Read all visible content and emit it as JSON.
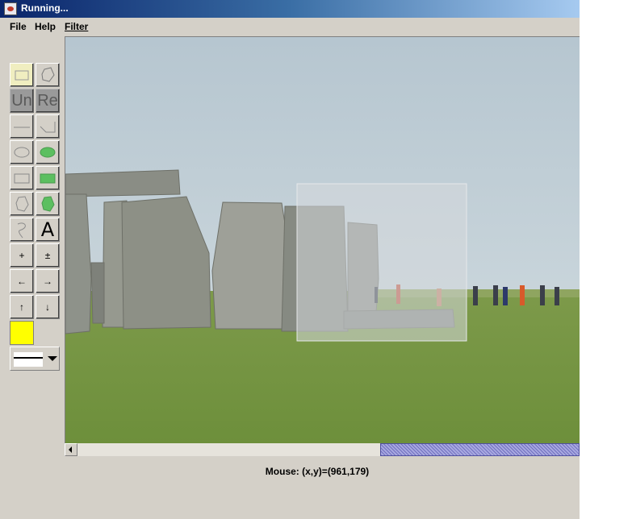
{
  "window": {
    "title": "Running..."
  },
  "menubar": {
    "items": [
      "File",
      "Help",
      "Filter"
    ]
  },
  "toolbar": {
    "buttons": [
      {
        "name": "select-rectangle-tool",
        "icon": "rectangle-select-icon",
        "selected": true
      },
      {
        "name": "select-lasso-tool",
        "icon": "lasso-select-icon"
      },
      {
        "name": "undo-button",
        "label": "Un",
        "disabled": true
      },
      {
        "name": "redo-button",
        "label": "Re",
        "disabled": true
      },
      {
        "name": "line-tool",
        "icon": "line-icon"
      },
      {
        "name": "polyline-tool",
        "icon": "polyline-icon"
      },
      {
        "name": "ellipse-tool",
        "icon": "ellipse-outline-icon"
      },
      {
        "name": "filled-ellipse-tool",
        "icon": "ellipse-filled-icon"
      },
      {
        "name": "rectangle-tool",
        "icon": "rectangle-outline-icon"
      },
      {
        "name": "filled-rectangle-tool",
        "icon": "rectangle-filled-icon"
      },
      {
        "name": "polygon-tool",
        "icon": "polygon-outline-icon"
      },
      {
        "name": "filled-polygon-tool",
        "icon": "polygon-filled-icon"
      },
      {
        "name": "freehand-tool",
        "icon": "freehand-icon"
      },
      {
        "name": "text-tool",
        "label": "A"
      },
      {
        "name": "zoom-in-button",
        "label": "+"
      },
      {
        "name": "zoom-toggle-button",
        "label": "±"
      },
      {
        "name": "move-left-button",
        "label": "←"
      },
      {
        "name": "move-right-button",
        "label": "→"
      },
      {
        "name": "move-up-button",
        "label": "↑"
      },
      {
        "name": "move-down-button",
        "label": "↓"
      }
    ],
    "color_swatch": "#ffff00",
    "line_style": "solid"
  },
  "status": {
    "mouse_text": "Mouse: (x,y)=(961,179)"
  },
  "colors": {
    "titlebar_start": "#0a246a",
    "titlebar_end": "#a6caf0",
    "window_bg": "#d4d0c8",
    "scroll_thumb": "#9090d0",
    "tool_fill": "#5cbf60"
  }
}
